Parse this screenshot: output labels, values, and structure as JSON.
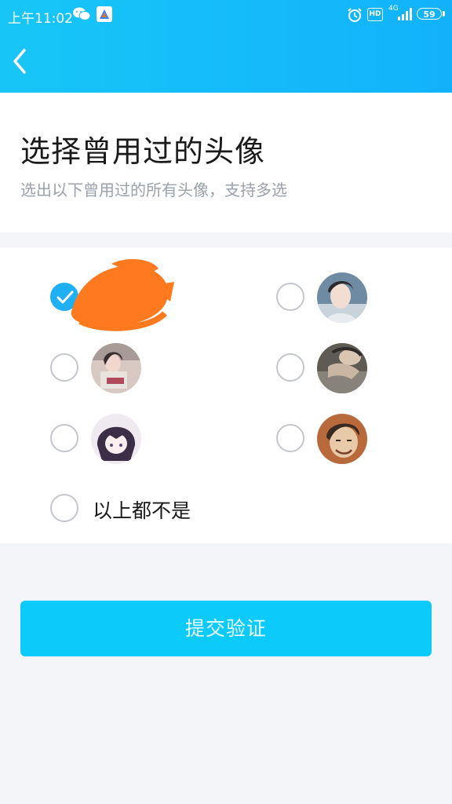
{
  "status_bar": {
    "time": "上午11:02",
    "hd_label": "HD",
    "network_label": "4G",
    "battery_level": "59",
    "icons": [
      "wechat-icon",
      "app-icon",
      "alarm-icon",
      "signal-icon",
      "battery-icon"
    ]
  },
  "nav": {
    "back_icon": "chevron-left-icon",
    "header_color": "#12b8fa"
  },
  "page": {
    "title": "选择曾用过的头像",
    "subtitle": "选出以下曾用过的所有头像，支持多选"
  },
  "avatar_options": [
    {
      "id": "avatar-1",
      "checked": true,
      "note": "avatar redacted with orange scribble"
    },
    {
      "id": "avatar-2",
      "checked": false
    },
    {
      "id": "avatar-3",
      "checked": false
    },
    {
      "id": "avatar-4",
      "checked": false
    },
    {
      "id": "avatar-5",
      "checked": false
    },
    {
      "id": "avatar-6",
      "checked": false
    }
  ],
  "none_option": {
    "label": "以上都不是",
    "checked": false
  },
  "submit": {
    "label": "提交验证",
    "color": "#0ccbfa"
  },
  "colors": {
    "accent": "#1fb0f3",
    "background": "#f3f5f8",
    "redaction": "#ff7a1f"
  }
}
